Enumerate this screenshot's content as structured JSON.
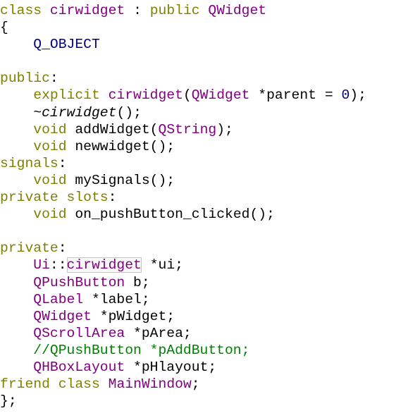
{
  "colors": {
    "keyword": "#808000",
    "type": "#800080",
    "plain": "#000000",
    "comment": "#008000",
    "number": "#000080",
    "punct": "#000000"
  },
  "code": {
    "lines": [
      [
        {
          "t": "class",
          "c": "keyword"
        },
        {
          "t": " ",
          "c": "plain"
        },
        {
          "t": "cirwidget",
          "c": "type"
        },
        {
          "t": " : ",
          "c": "plain"
        },
        {
          "t": "public",
          "c": "keyword"
        },
        {
          "t": " ",
          "c": "plain"
        },
        {
          "t": "QWidget",
          "c": "type"
        }
      ],
      [
        {
          "t": "{",
          "c": "plain"
        }
      ],
      [
        {
          "t": "    ",
          "c": "plain"
        },
        {
          "t": "Q_OBJECT",
          "c": "number"
        }
      ],
      [],
      [
        {
          "t": "public",
          "c": "keyword"
        },
        {
          "t": ":",
          "c": "plain"
        }
      ],
      [
        {
          "t": "    ",
          "c": "plain"
        },
        {
          "t": "explicit",
          "c": "keyword"
        },
        {
          "t": " ",
          "c": "plain"
        },
        {
          "t": "cirwidget",
          "c": "type"
        },
        {
          "t": "(",
          "c": "plain"
        },
        {
          "t": "QWidget",
          "c": "type"
        },
        {
          "t": " *parent = ",
          "c": "plain"
        },
        {
          "t": "0",
          "c": "number"
        },
        {
          "t": ");",
          "c": "plain"
        }
      ],
      [
        {
          "t": "    ",
          "c": "plain"
        },
        {
          "t": "~",
          "c": "plain"
        },
        {
          "t": "cirwidget",
          "c": "plain",
          "italic": true
        },
        {
          "t": "();",
          "c": "plain"
        }
      ],
      [
        {
          "t": "    ",
          "c": "plain"
        },
        {
          "t": "void",
          "c": "keyword"
        },
        {
          "t": " addWidget(",
          "c": "plain"
        },
        {
          "t": "QString",
          "c": "type"
        },
        {
          "t": ");",
          "c": "plain"
        }
      ],
      [
        {
          "t": "    ",
          "c": "plain"
        },
        {
          "t": "void",
          "c": "keyword"
        },
        {
          "t": " newwidget();",
          "c": "plain"
        }
      ],
      [
        {
          "t": "signals",
          "c": "keyword"
        },
        {
          "t": ":",
          "c": "plain"
        }
      ],
      [
        {
          "t": "    ",
          "c": "plain"
        },
        {
          "t": "void",
          "c": "keyword"
        },
        {
          "t": " mySignals();",
          "c": "plain"
        }
      ],
      [
        {
          "t": "private",
          "c": "keyword"
        },
        {
          "t": " ",
          "c": "plain"
        },
        {
          "t": "slots",
          "c": "keyword"
        },
        {
          "t": ":",
          "c": "plain"
        }
      ],
      [
        {
          "t": "    ",
          "c": "plain"
        },
        {
          "t": "void",
          "c": "keyword"
        },
        {
          "t": " on_pushButton_clicked();",
          "c": "plain"
        }
      ],
      [],
      [
        {
          "t": "private",
          "c": "keyword"
        },
        {
          "t": ":",
          "c": "plain"
        }
      ],
      [
        {
          "t": "    ",
          "c": "plain"
        },
        {
          "t": "Ui",
          "c": "type"
        },
        {
          "t": "::",
          "c": "plain"
        },
        {
          "t": "cirwidget",
          "c": "type",
          "boxed": true
        },
        {
          "t": " *ui;",
          "c": "plain"
        }
      ],
      [
        {
          "t": "    ",
          "c": "plain"
        },
        {
          "t": "QPushButton",
          "c": "type"
        },
        {
          "t": " b;",
          "c": "plain"
        }
      ],
      [
        {
          "t": "    ",
          "c": "plain"
        },
        {
          "t": "QLabel",
          "c": "type"
        },
        {
          "t": " *label;",
          "c": "plain"
        }
      ],
      [
        {
          "t": "    ",
          "c": "plain"
        },
        {
          "t": "QWidget",
          "c": "type"
        },
        {
          "t": " *pWidget;",
          "c": "plain"
        }
      ],
      [
        {
          "t": "    ",
          "c": "plain"
        },
        {
          "t": "QScrollArea",
          "c": "type"
        },
        {
          "t": " *pArea;",
          "c": "plain"
        }
      ],
      [
        {
          "t": "    ",
          "c": "plain"
        },
        {
          "t": "//QPushButton *pAddButton;",
          "c": "comment"
        }
      ],
      [
        {
          "t": "    ",
          "c": "plain"
        },
        {
          "t": "QHBoxLayout",
          "c": "type"
        },
        {
          "t": " *pHlayout;",
          "c": "plain"
        }
      ],
      [
        {
          "t": "friend",
          "c": "keyword"
        },
        {
          "t": " ",
          "c": "plain"
        },
        {
          "t": "class",
          "c": "keyword"
        },
        {
          "t": " ",
          "c": "plain"
        },
        {
          "t": "MainWindow",
          "c": "type"
        },
        {
          "t": ";",
          "c": "plain"
        }
      ],
      [
        {
          "t": "};",
          "c": "plain"
        }
      ]
    ]
  }
}
